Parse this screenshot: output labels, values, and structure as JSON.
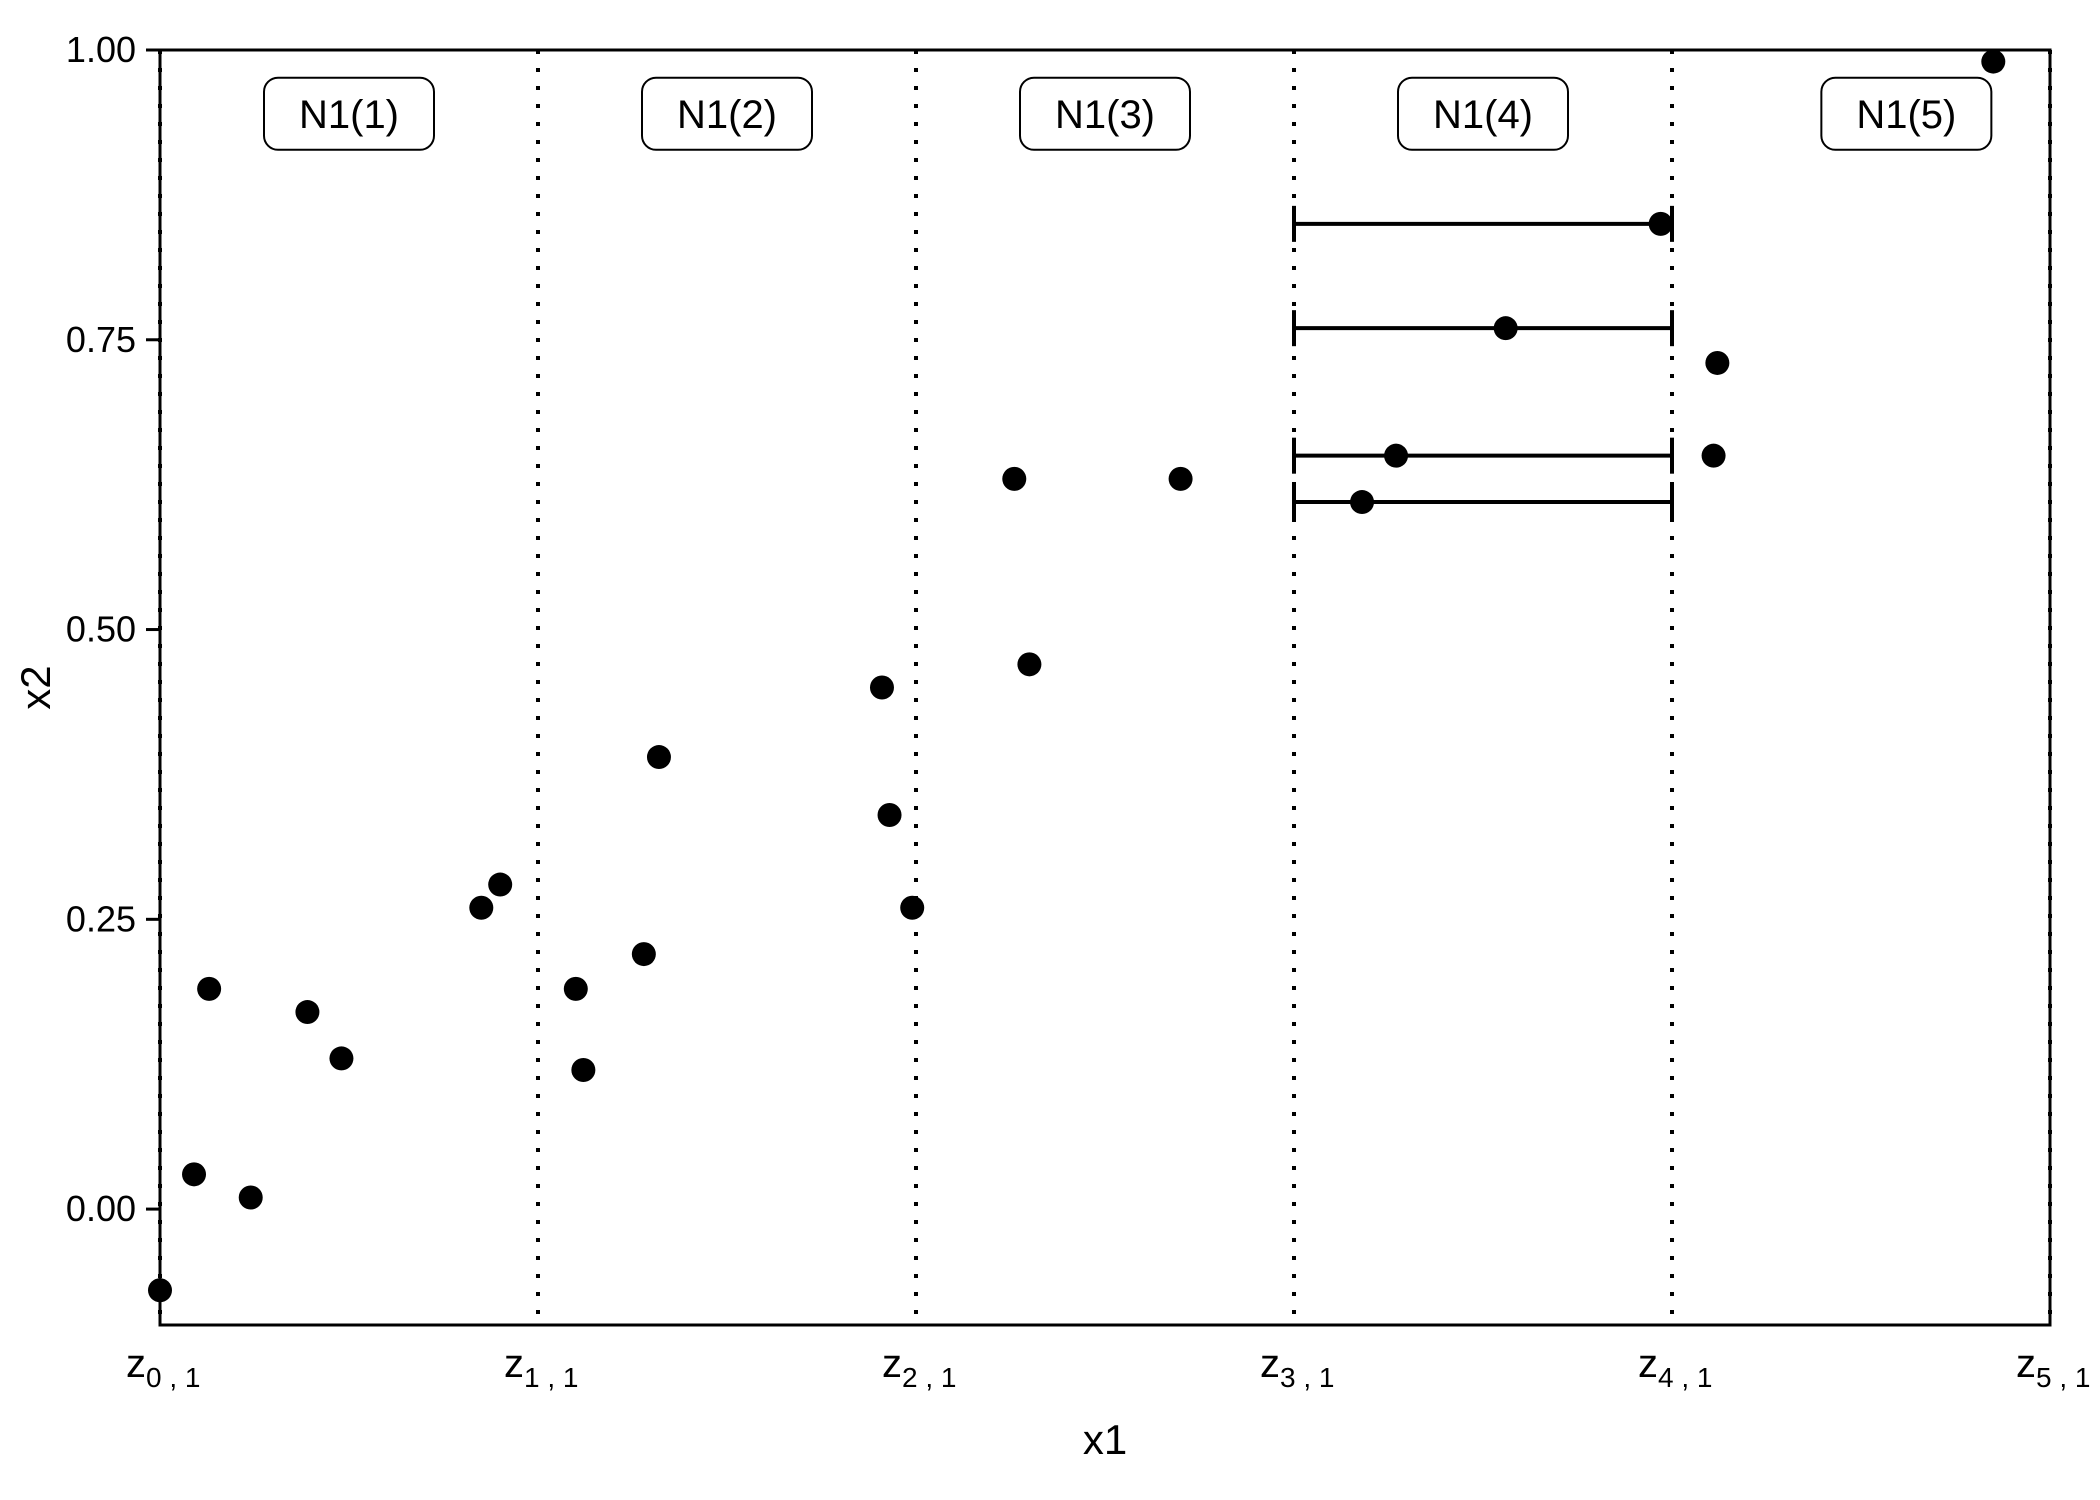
{
  "chart_data": {
    "type": "scatter",
    "xlabel": "x1",
    "ylabel": "x2",
    "ylim": [
      -0.1,
      1.0
    ],
    "xlim": [
      0,
      5
    ],
    "y_ticks": [
      0.0,
      0.25,
      0.5,
      0.75,
      1.0
    ],
    "x_tick_labels": [
      "z0 , 1",
      "z1 , 1",
      "z2 , 1",
      "z3 , 1",
      "z4 , 1",
      "z5 , 1"
    ],
    "x_tick_positions": [
      0,
      1,
      2,
      3,
      4,
      5
    ],
    "vlines": [
      0,
      1,
      2,
      3,
      4,
      5
    ],
    "bin_labels": [
      {
        "text": "N1(1)",
        "x": 0.5
      },
      {
        "text": "N1(2)",
        "x": 1.5
      },
      {
        "text": "N1(3)",
        "x": 2.5
      },
      {
        "text": "N1(4)",
        "x": 3.5
      },
      {
        "text": "N1(5)",
        "x": 4.62
      }
    ],
    "points": [
      {
        "x": 0.0,
        "y": -0.07
      },
      {
        "x": 0.09,
        "y": 0.03
      },
      {
        "x": 0.13,
        "y": 0.19
      },
      {
        "x": 0.24,
        "y": 0.01
      },
      {
        "x": 0.39,
        "y": 0.17
      },
      {
        "x": 0.48,
        "y": 0.13
      },
      {
        "x": 0.85,
        "y": 0.26
      },
      {
        "x": 0.9,
        "y": 0.28
      },
      {
        "x": 1.1,
        "y": 0.19
      },
      {
        "x": 1.12,
        "y": 0.12
      },
      {
        "x": 1.28,
        "y": 0.22
      },
      {
        "x": 1.32,
        "y": 0.39
      },
      {
        "x": 1.91,
        "y": 0.45
      },
      {
        "x": 1.93,
        "y": 0.34
      },
      {
        "x": 1.99,
        "y": 0.26
      },
      {
        "x": 2.26,
        "y": 0.63
      },
      {
        "x": 2.3,
        "y": 0.47
      },
      {
        "x": 2.7,
        "y": 0.63
      },
      {
        "x": 3.18,
        "y": 0.61
      },
      {
        "x": 3.27,
        "y": 0.65
      },
      {
        "x": 3.56,
        "y": 0.76
      },
      {
        "x": 3.97,
        "y": 0.85
      },
      {
        "x": 4.11,
        "y": 0.65
      },
      {
        "x": 4.12,
        "y": 0.73
      },
      {
        "x": 4.85,
        "y": 0.99
      }
    ],
    "intervals": [
      {
        "y": 0.85,
        "x0": 3.0,
        "x1": 4.0
      },
      {
        "y": 0.76,
        "x0": 3.0,
        "x1": 4.0
      },
      {
        "y": 0.65,
        "x0": 3.0,
        "x1": 4.0
      },
      {
        "y": 0.61,
        "x0": 3.0,
        "x1": 4.0
      }
    ]
  },
  "axis": {
    "yticks": {
      "t0": "0.00",
      "t1": "0.25",
      "t2": "0.50",
      "t3": "0.75",
      "t4": "1.00"
    },
    "xlabel": "x1",
    "ylabel": "x2"
  },
  "binlabels": {
    "b0": "N1(1)",
    "b1": "N1(2)",
    "b2": "N1(3)",
    "b3": "N1(4)",
    "b4": "N1(5)"
  },
  "xticks": {
    "z0a": "z",
    "z0b": "0 , 1",
    "z1a": "z",
    "z1b": "1 , 1",
    "z2a": "z",
    "z2b": "2 , 1",
    "z3a": "z",
    "z3b": "3 , 1",
    "z4a": "z",
    "z4b": "4 , 1",
    "z5a": "z",
    "z5b": "5 , 1"
  }
}
